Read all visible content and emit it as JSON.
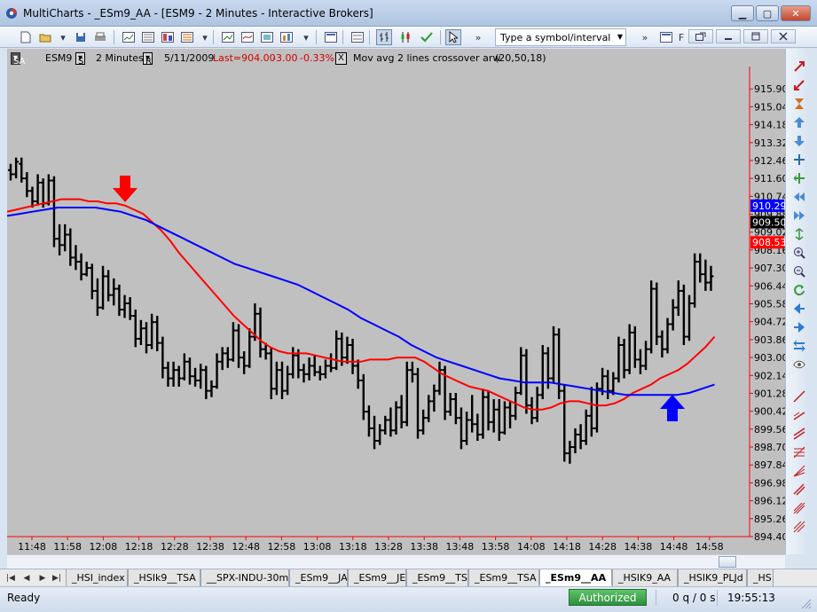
{
  "window": {
    "title": "MultiCharts - _ESm9_AA - [ESM9 - 2 Minutes - Interactive Brokers]",
    "minimize_glyph": "▁",
    "maximize_glyph": "▢",
    "close_glyph": "✕"
  },
  "toolbar": {
    "symbol_placeholder": "Type a symbol/interval",
    "frag_f": "F",
    "icons": [
      "new-document-icon",
      "open-folder-icon",
      "save-icon",
      "print-icon",
      "chart-window-icon",
      "quote-manager-icon",
      "scanner-icon",
      "dom-icon",
      "new-chart-icon",
      "insert-study-icon",
      "format-window-icon",
      "portfolio-icon",
      "dropdown-arrow-icon",
      "workspace-icon",
      "bar-chart-icon",
      "candlestick-icon",
      "checkmark-icon",
      "cursor-icon",
      "more-icon"
    ]
  },
  "infobar": {
    "style_btn": "SA",
    "symbol": "ESM9",
    "settings_btn": "S",
    "interval": "2 Minutes",
    "range_btn": "R",
    "date": "5/11/2009",
    "last": "Last=904.00",
    "change": "-3.00",
    "change_pct": "-0.33%",
    "close_glyph": "X",
    "study": "Mov avg 2 lines crossover arw",
    "study_params": "(20,50,18)"
  },
  "chart_data": {
    "type": "bar",
    "subtype": "ohlc",
    "symbol": "ESM9",
    "interval": "2 Minutes",
    "ylim": [
      894.4,
      916.76
    ],
    "y_ticks": [
      894.4,
      895.26,
      896.12,
      896.98,
      897.84,
      898.7,
      899.56,
      900.42,
      901.28,
      902.14,
      903.0,
      903.86,
      904.72,
      905.58,
      906.44,
      907.3,
      908.16,
      909.02,
      909.88,
      910.74,
      911.6,
      912.46,
      913.32,
      914.18,
      915.04,
      915.9
    ],
    "y_tick_labels": [
      "894.40",
      "895.26",
      "896.12",
      "896.98",
      "897.84",
      "898.70",
      "899.56",
      "900.42",
      "901.28",
      "902.14",
      "903.00",
      "903.86",
      "904.72",
      "905.58",
      "906.44",
      "907.30",
      "908.16",
      "909.02",
      "909.88",
      "910.74",
      "911.60",
      "912.46",
      "913.32",
      "914.18",
      "915.04",
      "915.90"
    ],
    "x_tick_labels": [
      "11:48",
      "11:58",
      "12:08",
      "12:18",
      "12:28",
      "12:38",
      "12:48",
      "12:58",
      "13:08",
      "13:18",
      "13:28",
      "13:38",
      "13:48",
      "13:58",
      "14:08",
      "14:18",
      "14:28",
      "14:38",
      "14:48",
      "14:58"
    ],
    "price_markers": [
      {
        "value": 910.29,
        "label": "910.29",
        "color": "#0000ff"
      },
      {
        "value": 909.5,
        "label": "909.50",
        "color": "#000000"
      },
      {
        "value": 908.53,
        "label": "908.53",
        "color": "#ff0000"
      }
    ],
    "bars": [
      {
        "o": 912.0,
        "h": 912.3,
        "l": 911.5,
        "c": 911.8
      },
      {
        "o": 911.8,
        "h": 912.6,
        "l": 911.6,
        "c": 912.4
      },
      {
        "o": 912.3,
        "h": 912.6,
        "l": 911.4,
        "c": 911.6
      },
      {
        "o": 911.6,
        "h": 911.9,
        "l": 910.7,
        "c": 911.0
      },
      {
        "o": 911.0,
        "h": 911.2,
        "l": 910.2,
        "c": 910.5
      },
      {
        "o": 910.5,
        "h": 911.8,
        "l": 910.3,
        "c": 911.4
      },
      {
        "o": 911.4,
        "h": 911.6,
        "l": 910.2,
        "c": 910.4
      },
      {
        "o": 910.4,
        "h": 911.8,
        "l": 910.3,
        "c": 911.5
      },
      {
        "o": 911.5,
        "h": 911.7,
        "l": 908.3,
        "c": 908.7
      },
      {
        "o": 908.7,
        "h": 909.4,
        "l": 907.9,
        "c": 908.4
      },
      {
        "o": 908.4,
        "h": 909.4,
        "l": 908.1,
        "c": 908.9
      },
      {
        "o": 908.9,
        "h": 909.2,
        "l": 907.4,
        "c": 907.8
      },
      {
        "o": 907.8,
        "h": 908.4,
        "l": 907.2,
        "c": 907.6
      },
      {
        "o": 907.6,
        "h": 908.0,
        "l": 906.7,
        "c": 907.0
      },
      {
        "o": 907.0,
        "h": 907.6,
        "l": 906.9,
        "c": 907.3
      },
      {
        "o": 907.3,
        "h": 907.5,
        "l": 905.8,
        "c": 906.2
      },
      {
        "o": 906.2,
        "h": 906.8,
        "l": 905.0,
        "c": 905.4
      },
      {
        "o": 905.4,
        "h": 907.4,
        "l": 905.3,
        "c": 906.9
      },
      {
        "o": 906.9,
        "h": 907.2,
        "l": 905.7,
        "c": 906.0
      },
      {
        "o": 906.0,
        "h": 906.8,
        "l": 905.5,
        "c": 906.3
      },
      {
        "o": 906.3,
        "h": 906.5,
        "l": 905.0,
        "c": 905.3
      },
      {
        "o": 905.3,
        "h": 906.0,
        "l": 904.9,
        "c": 905.6
      },
      {
        "o": 905.6,
        "h": 905.9,
        "l": 904.8,
        "c": 905.0
      },
      {
        "o": 905.0,
        "h": 905.3,
        "l": 903.5,
        "c": 903.9
      },
      {
        "o": 903.9,
        "h": 904.8,
        "l": 903.6,
        "c": 904.4
      },
      {
        "o": 904.4,
        "h": 904.7,
        "l": 903.2,
        "c": 903.6
      },
      {
        "o": 903.6,
        "h": 905.1,
        "l": 903.4,
        "c": 904.7
      },
      {
        "o": 904.7,
        "h": 905.0,
        "l": 903.3,
        "c": 903.7
      },
      {
        "o": 903.7,
        "h": 904.0,
        "l": 902.0,
        "c": 902.5
      },
      {
        "o": 902.5,
        "h": 902.8,
        "l": 901.6,
        "c": 902.0
      },
      {
        "o": 902.0,
        "h": 902.8,
        "l": 901.6,
        "c": 902.4
      },
      {
        "o": 902.4,
        "h": 902.6,
        "l": 901.6,
        "c": 902.0
      },
      {
        "o": 902.0,
        "h": 903.2,
        "l": 901.9,
        "c": 902.8
      },
      {
        "o": 902.8,
        "h": 903.0,
        "l": 901.7,
        "c": 902.1
      },
      {
        "o": 902.1,
        "h": 902.5,
        "l": 901.6,
        "c": 901.9
      },
      {
        "o": 901.9,
        "h": 902.7,
        "l": 901.5,
        "c": 902.4
      },
      {
        "o": 902.4,
        "h": 902.6,
        "l": 901.0,
        "c": 901.4
      },
      {
        "o": 901.4,
        "h": 901.9,
        "l": 901.1,
        "c": 901.6
      },
      {
        "o": 901.6,
        "h": 903.2,
        "l": 901.5,
        "c": 902.8
      },
      {
        "o": 902.8,
        "h": 903.5,
        "l": 902.4,
        "c": 903.2
      },
      {
        "o": 903.2,
        "h": 903.5,
        "l": 902.5,
        "c": 902.9
      },
      {
        "o": 902.9,
        "h": 904.7,
        "l": 902.8,
        "c": 904.3
      },
      {
        "o": 904.3,
        "h": 904.6,
        "l": 902.5,
        "c": 903.0
      },
      {
        "o": 903.0,
        "h": 903.3,
        "l": 902.2,
        "c": 902.6
      },
      {
        "o": 902.6,
        "h": 904.4,
        "l": 902.5,
        "c": 904.0
      },
      {
        "o": 904.0,
        "h": 905.6,
        "l": 903.8,
        "c": 905.1
      },
      {
        "o": 905.1,
        "h": 905.4,
        "l": 903.0,
        "c": 903.4
      },
      {
        "o": 903.4,
        "h": 903.7,
        "l": 902.9,
        "c": 903.2
      },
      {
        "o": 903.2,
        "h": 903.5,
        "l": 901.0,
        "c": 901.5
      },
      {
        "o": 901.5,
        "h": 902.8,
        "l": 901.2,
        "c": 902.4
      },
      {
        "o": 902.4,
        "h": 902.8,
        "l": 901.0,
        "c": 901.4
      },
      {
        "o": 901.4,
        "h": 902.6,
        "l": 901.2,
        "c": 902.2
      },
      {
        "o": 902.2,
        "h": 903.5,
        "l": 902.0,
        "c": 903.1
      },
      {
        "o": 903.1,
        "h": 903.4,
        "l": 902.0,
        "c": 902.4
      },
      {
        "o": 902.4,
        "h": 902.7,
        "l": 901.8,
        "c": 902.2
      },
      {
        "o": 902.2,
        "h": 903.0,
        "l": 901.9,
        "c": 902.6
      },
      {
        "o": 902.6,
        "h": 903.1,
        "l": 902.1,
        "c": 902.3
      },
      {
        "o": 902.3,
        "h": 902.6,
        "l": 901.9,
        "c": 902.2
      },
      {
        "o": 902.2,
        "h": 902.9,
        "l": 902.0,
        "c": 902.6
      },
      {
        "o": 902.6,
        "h": 903.2,
        "l": 902.3,
        "c": 902.5
      },
      {
        "o": 902.5,
        "h": 904.3,
        "l": 902.4,
        "c": 903.9
      },
      {
        "o": 903.9,
        "h": 904.2,
        "l": 902.6,
        "c": 903.0
      },
      {
        "o": 903.0,
        "h": 904.0,
        "l": 902.7,
        "c": 903.6
      },
      {
        "o": 903.6,
        "h": 903.9,
        "l": 902.2,
        "c": 902.6
      },
      {
        "o": 902.6,
        "h": 902.9,
        "l": 901.5,
        "c": 901.9
      },
      {
        "o": 901.9,
        "h": 902.2,
        "l": 900.0,
        "c": 900.4
      },
      {
        "o": 900.4,
        "h": 900.7,
        "l": 899.2,
        "c": 899.6
      },
      {
        "o": 899.6,
        "h": 900.2,
        "l": 898.6,
        "c": 899.0
      },
      {
        "o": 899.0,
        "h": 899.8,
        "l": 898.8,
        "c": 899.5
      },
      {
        "o": 899.5,
        "h": 900.2,
        "l": 899.3,
        "c": 900.0
      },
      {
        "o": 900.0,
        "h": 900.6,
        "l": 899.2,
        "c": 899.5
      },
      {
        "o": 899.5,
        "h": 900.9,
        "l": 899.3,
        "c": 900.6
      },
      {
        "o": 900.6,
        "h": 901.2,
        "l": 899.6,
        "c": 899.9
      },
      {
        "o": 899.9,
        "h": 902.8,
        "l": 899.7,
        "c": 902.4
      },
      {
        "o": 902.4,
        "h": 902.8,
        "l": 901.8,
        "c": 902.2
      },
      {
        "o": 902.2,
        "h": 902.5,
        "l": 899.1,
        "c": 899.5
      },
      {
        "o": 899.5,
        "h": 900.5,
        "l": 899.3,
        "c": 900.1
      },
      {
        "o": 900.1,
        "h": 901.2,
        "l": 899.9,
        "c": 900.9
      },
      {
        "o": 900.9,
        "h": 901.7,
        "l": 900.4,
        "c": 901.4
      },
      {
        "o": 901.4,
        "h": 902.8,
        "l": 901.2,
        "c": 902.4
      },
      {
        "o": 902.4,
        "h": 902.6,
        "l": 900.0,
        "c": 900.4
      },
      {
        "o": 900.4,
        "h": 901.3,
        "l": 900.2,
        "c": 901.0
      },
      {
        "o": 901.0,
        "h": 901.3,
        "l": 899.8,
        "c": 900.1
      },
      {
        "o": 900.1,
        "h": 900.6,
        "l": 898.6,
        "c": 899.0
      },
      {
        "o": 899.0,
        "h": 900.4,
        "l": 898.8,
        "c": 900.0
      },
      {
        "o": 900.0,
        "h": 901.2,
        "l": 899.4,
        "c": 899.8
      },
      {
        "o": 899.8,
        "h": 900.3,
        "l": 899.0,
        "c": 899.3
      },
      {
        "o": 899.3,
        "h": 901.5,
        "l": 899.1,
        "c": 901.1
      },
      {
        "o": 901.1,
        "h": 901.4,
        "l": 899.5,
        "c": 899.9
      },
      {
        "o": 899.9,
        "h": 901.0,
        "l": 899.4,
        "c": 900.5
      },
      {
        "o": 900.5,
        "h": 901.0,
        "l": 899.0,
        "c": 899.4
      },
      {
        "o": 899.4,
        "h": 900.9,
        "l": 899.3,
        "c": 900.6
      },
      {
        "o": 900.6,
        "h": 900.9,
        "l": 899.6,
        "c": 900.2
      },
      {
        "o": 900.2,
        "h": 901.6,
        "l": 900.0,
        "c": 901.3
      },
      {
        "o": 901.3,
        "h": 903.5,
        "l": 901.2,
        "c": 903.1
      },
      {
        "o": 903.1,
        "h": 903.4,
        "l": 900.3,
        "c": 900.7
      },
      {
        "o": 900.7,
        "h": 901.1,
        "l": 899.8,
        "c": 900.1
      },
      {
        "o": 900.1,
        "h": 901.6,
        "l": 899.9,
        "c": 901.2
      },
      {
        "o": 901.2,
        "h": 903.6,
        "l": 901.0,
        "c": 903.2
      },
      {
        "o": 903.2,
        "h": 903.5,
        "l": 901.5,
        "c": 902.0
      },
      {
        "o": 902.0,
        "h": 904.5,
        "l": 901.8,
        "c": 904.1
      },
      {
        "o": 904.1,
        "h": 904.4,
        "l": 901.0,
        "c": 901.4
      },
      {
        "o": 901.4,
        "h": 901.7,
        "l": 898.0,
        "c": 898.4
      },
      {
        "o": 898.4,
        "h": 899.0,
        "l": 897.9,
        "c": 898.7
      },
      {
        "o": 898.7,
        "h": 899.6,
        "l": 898.4,
        "c": 899.3
      },
      {
        "o": 899.3,
        "h": 899.8,
        "l": 898.6,
        "c": 899.0
      },
      {
        "o": 899.0,
        "h": 900.5,
        "l": 898.8,
        "c": 900.2
      },
      {
        "o": 900.2,
        "h": 901.6,
        "l": 899.2,
        "c": 899.6
      },
      {
        "o": 899.6,
        "h": 901.8,
        "l": 899.4,
        "c": 901.5
      },
      {
        "o": 901.5,
        "h": 902.5,
        "l": 901.2,
        "c": 902.1
      },
      {
        "o": 902.1,
        "h": 902.4,
        "l": 901.0,
        "c": 901.4
      },
      {
        "o": 901.4,
        "h": 902.3,
        "l": 901.2,
        "c": 902.0
      },
      {
        "o": 902.0,
        "h": 904.0,
        "l": 901.8,
        "c": 903.6
      },
      {
        "o": 903.6,
        "h": 903.9,
        "l": 902.0,
        "c": 902.4
      },
      {
        "o": 902.4,
        "h": 904.6,
        "l": 902.2,
        "c": 904.2
      },
      {
        "o": 904.2,
        "h": 904.5,
        "l": 902.5,
        "c": 902.9
      },
      {
        "o": 902.9,
        "h": 903.4,
        "l": 902.2,
        "c": 902.6
      },
      {
        "o": 902.6,
        "h": 903.8,
        "l": 902.4,
        "c": 903.4
      },
      {
        "o": 903.4,
        "h": 906.7,
        "l": 903.2,
        "c": 906.3
      },
      {
        "o": 906.3,
        "h": 906.6,
        "l": 903.6,
        "c": 904.0
      },
      {
        "o": 904.0,
        "h": 904.3,
        "l": 903.0,
        "c": 903.4
      },
      {
        "o": 903.4,
        "h": 904.9,
        "l": 903.2,
        "c": 904.6
      },
      {
        "o": 904.6,
        "h": 905.8,
        "l": 904.3,
        "c": 905.4
      },
      {
        "o": 905.4,
        "h": 906.7,
        "l": 905.0,
        "c": 906.2
      },
      {
        "o": 906.2,
        "h": 906.5,
        "l": 903.6,
        "c": 904.0
      },
      {
        "o": 904.0,
        "h": 906.0,
        "l": 903.8,
        "c": 905.6
      },
      {
        "o": 905.6,
        "h": 908.0,
        "l": 905.4,
        "c": 907.6
      },
      {
        "o": 907.6,
        "h": 908.0,
        "l": 906.6,
        "c": 907.0
      },
      {
        "o": 907.0,
        "h": 907.7,
        "l": 906.2,
        "c": 906.6
      },
      {
        "o": 906.6,
        "h": 907.4,
        "l": 906.2,
        "c": 906.9
      }
    ],
    "series": [
      {
        "color": "#ff0000",
        "values": [
          910.0,
          910.1,
          910.2,
          910.3,
          910.4,
          910.5,
          910.6,
          910.6,
          910.6,
          910.5,
          910.5,
          910.4,
          910.4,
          910.3,
          910.1,
          909.9,
          909.5,
          909.1,
          908.6,
          908.0,
          907.5,
          907.0,
          906.5,
          906.0,
          905.5,
          905.0,
          904.6,
          904.2,
          903.8,
          903.5,
          903.3,
          903.2,
          903.2,
          903.2,
          903.1,
          903.0,
          902.9,
          902.8,
          902.8,
          902.8,
          902.9,
          902.9,
          902.9,
          903.0,
          903.0,
          903.0,
          902.8,
          902.5,
          902.2,
          902.0,
          901.8,
          901.6,
          901.5,
          901.4,
          901.2,
          901.0,
          900.8,
          900.6,
          900.5,
          900.5,
          900.6,
          900.8,
          900.9,
          900.9,
          900.8,
          900.7,
          900.7,
          900.8,
          901.0,
          901.3,
          901.5,
          901.7,
          902.0,
          902.2,
          902.4,
          902.7,
          903.1,
          903.5,
          904.0
        ]
      },
      {
        "color": "#0000ff",
        "values": [
          909.8,
          909.9,
          910.0,
          910.1,
          910.2,
          910.2,
          910.2,
          910.2,
          910.1,
          910.0,
          909.8,
          909.6,
          909.3,
          909.0,
          908.7,
          908.4,
          908.1,
          907.8,
          907.5,
          907.3,
          907.1,
          906.9,
          906.7,
          906.5,
          906.2,
          905.9,
          905.6,
          905.3,
          904.9,
          904.6,
          904.3,
          904.0,
          903.6,
          903.3,
          903.0,
          902.8,
          902.6,
          902.4,
          902.2,
          902.0,
          901.9,
          901.8,
          901.8,
          901.8,
          901.7,
          901.6,
          901.5,
          901.4,
          901.3,
          901.2,
          901.2,
          901.2,
          901.2,
          901.2,
          901.3,
          901.5,
          901.7
        ]
      }
    ],
    "signals": [
      {
        "type": "sell",
        "bar_index": 26,
        "color": "#ff0000"
      },
      {
        "type": "buy",
        "bar_index": 108,
        "color": "#0000ff"
      }
    ],
    "grid": false
  },
  "draw_tools": [
    "zoom-in-icon",
    "zoom-out-icon",
    "hourglass-icon",
    "arrow-up-icon",
    "arrow-down-icon",
    "crosshair-icon",
    "select-icon",
    "magnifier-plus-icon",
    "magnifier-minus-icon",
    "refresh-icon",
    "scroll-left-icon",
    "scroll-right-icon",
    "bar-spacing-icon",
    "eye-icon",
    "line-draw-icon",
    "trendline-icon",
    "channel-icon",
    "fib-icon",
    "fan-icon",
    "arc-icon"
  ],
  "tabs": [
    "_HSI_index",
    "_HSIk9__TSA",
    "__SPX-INDU-30m",
    "_ESm9__JA",
    "_ESm9__JE",
    "_ESm9__TS",
    "_ESm9__TSA",
    "_ESm9__AA",
    "_HSIK9_AA",
    "_HSIK9_PLJd",
    "_HS"
  ],
  "active_tab": "_ESm9__AA",
  "status": {
    "ready": "Ready",
    "authorized": "Authorized",
    "queue": "0 q / 0 s",
    "clock": "19:55:13"
  }
}
